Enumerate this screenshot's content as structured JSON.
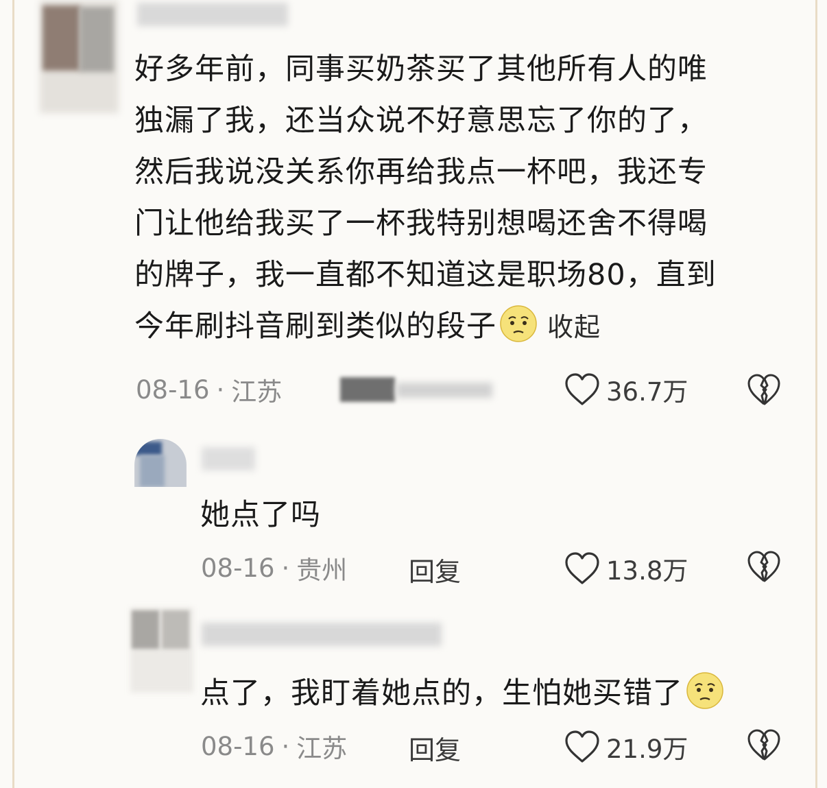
{
  "comments": [
    {
      "text_lines": [
        "好多年前，同事买奶茶买了其他所有人的唯",
        "独漏了我，还当众说不好意思忘了你的了，",
        "然后我说没关系你再给我点一杯吧，我还专",
        "门让他给我买了一杯我特别想喝还舍不得喝",
        "的牌子，我一直都不知道这是职场80，直到",
        "今年刷抖音刷到类似的段子"
      ],
      "emoji": "awkward-face-emoji",
      "collapse_label": "收起",
      "date": "08-16",
      "location": "江苏",
      "likes": "36.7万"
    },
    {
      "text": "她点了吗",
      "date": "08-16",
      "location": "贵州",
      "reply_label": "回复",
      "likes": "13.8万"
    },
    {
      "text": "点了，我盯着她点的，生怕她买错了",
      "emoji": "awkward-face-emoji",
      "date": "08-16",
      "location": "江苏",
      "reply_label": "回复",
      "likes": "21.9万"
    }
  ],
  "separator": "·",
  "colors": {
    "background": "#fbfaf7",
    "frame": "#e9dcc6",
    "text": "#1a1a1a",
    "meta": "#8a8a8a"
  }
}
